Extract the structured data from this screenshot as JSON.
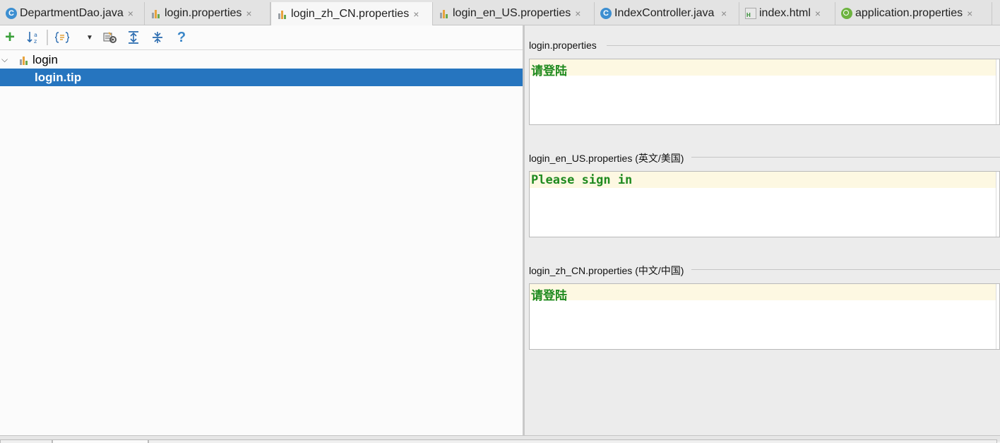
{
  "tabs": [
    {
      "label": "DepartmentDao.java",
      "icon": "java-class-icon",
      "active": false
    },
    {
      "label": "login.properties",
      "icon": "properties-file-icon",
      "active": false
    },
    {
      "label": "login_zh_CN.properties",
      "icon": "properties-file-icon",
      "active": true
    },
    {
      "label": "login_en_US.properties",
      "icon": "properties-file-icon",
      "active": false
    },
    {
      "label": "IndexController.java",
      "icon": "java-class-icon",
      "active": false
    },
    {
      "label": "index.html",
      "icon": "html-file-icon",
      "active": false
    },
    {
      "label": "application.properties",
      "icon": "spring-properties-icon",
      "active": false
    }
  ],
  "tab_close_glyph": "×",
  "toolbar": {
    "add": "+",
    "help": "?"
  },
  "tree": {
    "root_label": "login",
    "items": [
      {
        "label": "login.tip",
        "selected": true
      }
    ]
  },
  "editors": [
    {
      "label": "login.properties",
      "value": "请登陆"
    },
    {
      "label": "login_en_US.properties (英文/美国)",
      "value": "Please sign in"
    },
    {
      "label": "login_zh_CN.properties (中文/中国)",
      "value": "请登陆"
    }
  ],
  "colors": {
    "selection": "#2675bf",
    "value_text": "#1f8a1f",
    "class_icon": "#3d8fd1"
  }
}
